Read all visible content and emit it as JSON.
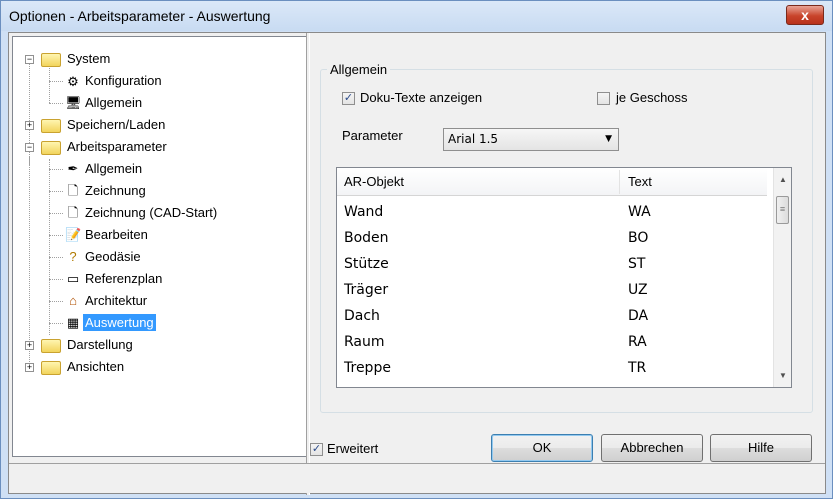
{
  "window": {
    "title": "Optionen - Arbeitsparameter - Auswertung",
    "close_label": "x"
  },
  "tree": {
    "nodes": [
      {
        "label": "System",
        "icon": "folder-open-icon",
        "expander": "−"
      },
      {
        "label": "Konfiguration",
        "icon": "configuration-icon"
      },
      {
        "label": "Allgemein",
        "icon": "monitor-icon"
      },
      {
        "label": "Speichern/Laden",
        "icon": "folder-icon",
        "expander": "+"
      },
      {
        "label": "Arbeitsparameter",
        "icon": "folder-open-icon",
        "expander": "−"
      },
      {
        "label": "Allgemein",
        "icon": "pen-icon"
      },
      {
        "label": "Zeichnung",
        "icon": "page-icon"
      },
      {
        "label": "Zeichnung (CAD-Start)",
        "icon": "page-icon"
      },
      {
        "label": "Bearbeiten",
        "icon": "edit-icon"
      },
      {
        "label": "Geodäsie",
        "icon": "geodesy-icon"
      },
      {
        "label": "Referenzplan",
        "icon": "reference-plan-icon"
      },
      {
        "label": "Architektur",
        "icon": "house-icon"
      },
      {
        "label": "Auswertung",
        "icon": "evaluation-icon",
        "selected": true
      },
      {
        "label": "Darstellung",
        "icon": "folder-icon",
        "expander": "+"
      },
      {
        "label": "Ansichten",
        "icon": "folder-icon",
        "expander": "+"
      }
    ]
  },
  "group": {
    "title": "Allgemein",
    "doku_label": "Doku-Texte anzeigen",
    "doku_checked": "✓",
    "geschoss_label": "je Geschoss",
    "param_label": "Parameter",
    "param_value": "Arial 1.5"
  },
  "list": {
    "columns": [
      "AR-Objekt",
      "Text"
    ],
    "rows": [
      [
        "Wand",
        "WA"
      ],
      [
        "Boden",
        "BO"
      ],
      [
        "Stütze",
        "ST"
      ],
      [
        "Träger",
        "UZ"
      ],
      [
        "Dach",
        "DA"
      ],
      [
        "Raum",
        "RA"
      ],
      [
        "Treppe",
        "TR"
      ]
    ],
    "scroll_up": "▲",
    "scroll_down": "▼",
    "thumb_grip": "≡"
  },
  "footer": {
    "erweitert_label": "Erweitert",
    "erweitert_checked": "✓",
    "ok_label": "OK",
    "abbrechen_label": "Abbrechen",
    "hilfe_label": "Hilfe"
  },
  "colors": {
    "selection": "#3399ff",
    "titlebar": "#c8dbf2",
    "close": "#c8442b"
  }
}
